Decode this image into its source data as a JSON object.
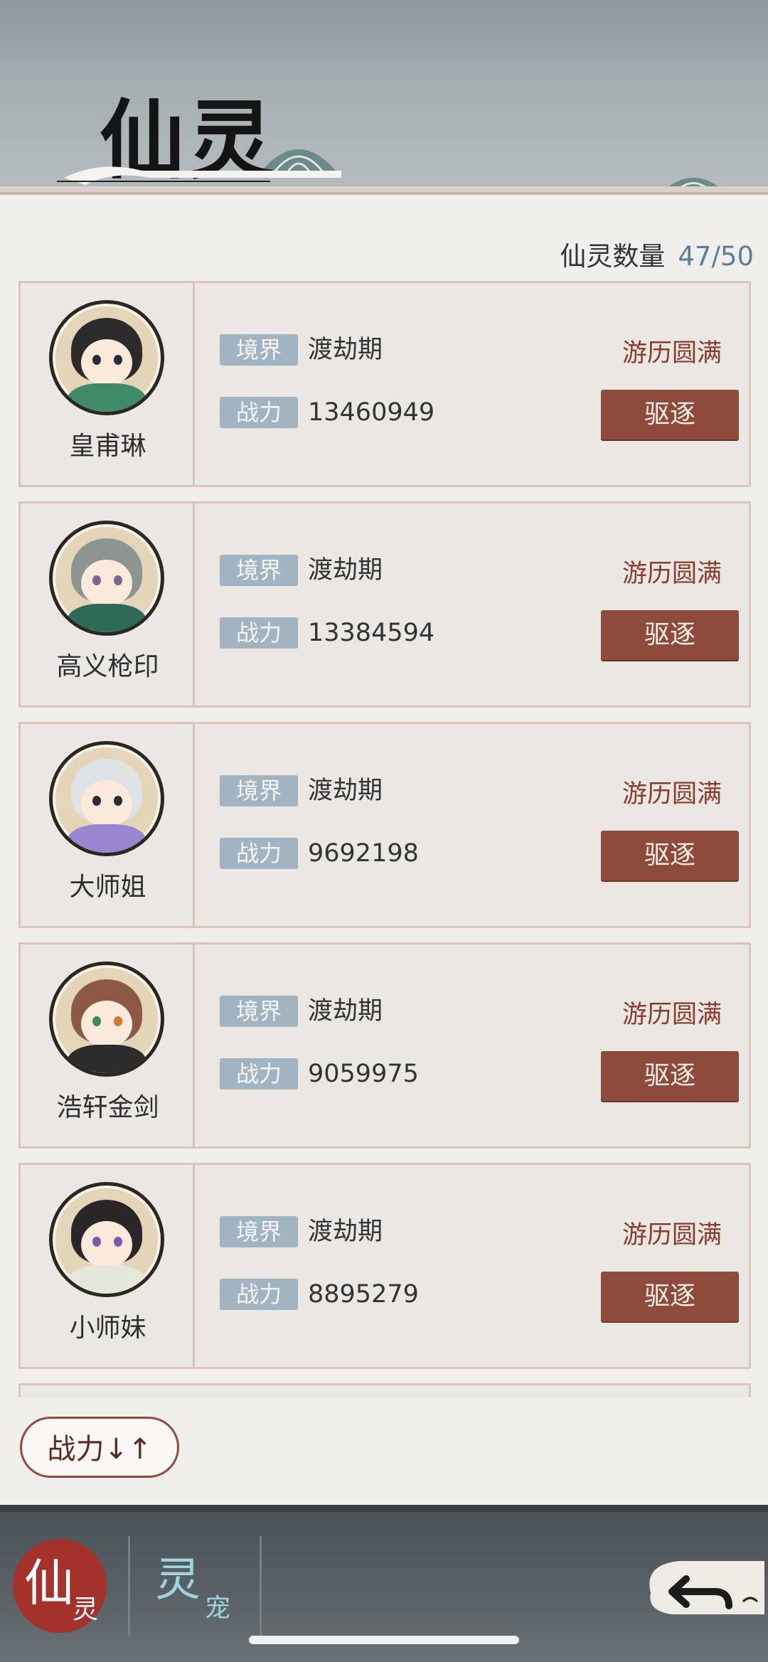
{
  "header": {
    "title": "仙灵"
  },
  "count": {
    "label": "仙灵数量",
    "value": "47/50"
  },
  "labels": {
    "realm": "境界",
    "power": "战力"
  },
  "cards": [
    {
      "name": "皇甫琳",
      "realm": "渡劫期",
      "power": "13460949",
      "status": "游历圆满",
      "action": "驱逐"
    },
    {
      "name": "高义枪印",
      "realm": "渡劫期",
      "power": "13384594",
      "status": "游历圆满",
      "action": "驱逐"
    },
    {
      "name": "大师姐",
      "realm": "渡劫期",
      "power": "9692198",
      "status": "游历圆满",
      "action": "驱逐"
    },
    {
      "name": "浩轩金剑",
      "realm": "渡劫期",
      "power": "9059975",
      "status": "游历圆满",
      "action": "驱逐"
    },
    {
      "name": "小师妹",
      "realm": "渡劫期",
      "power": "8895279",
      "status": "游历圆满",
      "action": "驱逐"
    }
  ],
  "sort": {
    "label": "战力↓↑"
  },
  "tabs": [
    {
      "main": "仙",
      "sub": "灵"
    },
    {
      "main": "灵",
      "sub": "宠"
    }
  ],
  "colors": {
    "accent_red": "#8e4a3b",
    "tag_blue": "#a2b4c2",
    "panel": "#f1efec"
  },
  "icons": {
    "back": "back-arrow-icon"
  }
}
